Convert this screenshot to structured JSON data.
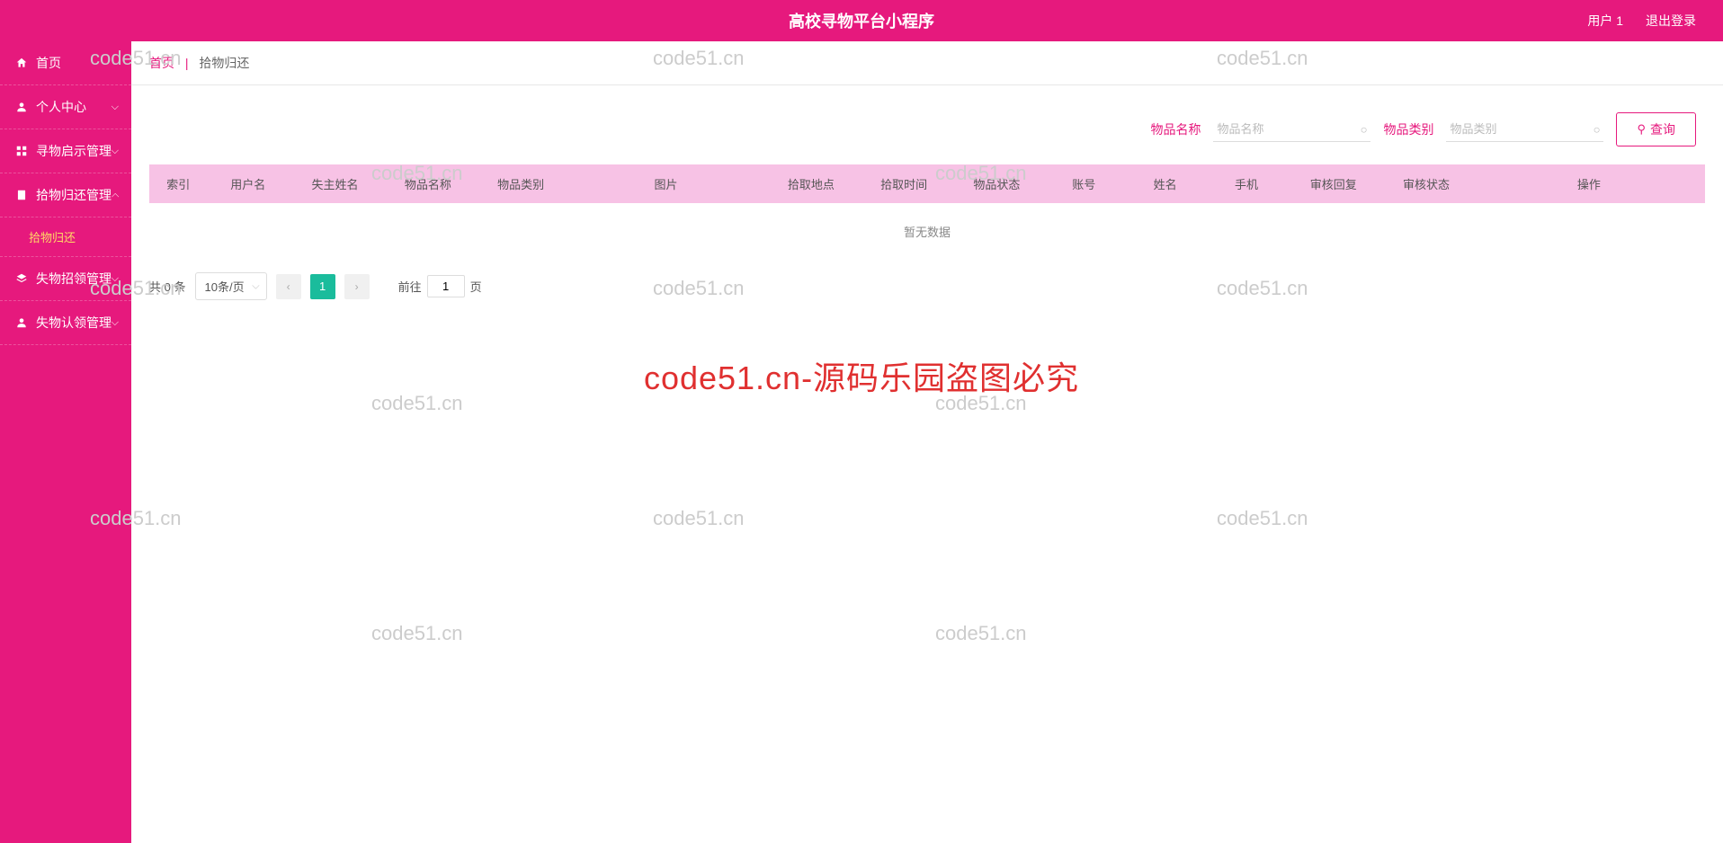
{
  "header": {
    "title": "高校寻物平台小程序",
    "user": "用户 1",
    "logout": "退出登录"
  },
  "sidebar": {
    "items": [
      {
        "label": "首页",
        "icon": "home",
        "expandable": false
      },
      {
        "label": "个人中心",
        "icon": "user",
        "expandable": true
      },
      {
        "label": "寻物启示管理",
        "icon": "grid",
        "expandable": true
      },
      {
        "label": "拾物归还管理",
        "icon": "doc",
        "expandable": true,
        "expanded": true,
        "children": [
          {
            "label": "拾物归还"
          }
        ]
      },
      {
        "label": "失物招领管理",
        "icon": "layers",
        "expandable": true
      },
      {
        "label": "失物认领管理",
        "icon": "user",
        "expandable": true
      }
    ]
  },
  "breadcrumb": {
    "home": "首页",
    "current": "拾物归还"
  },
  "search": {
    "label1": "物品名称",
    "placeholder1": "物品名称",
    "label2": "物品类别",
    "placeholder2": "物品类别",
    "button": "查询"
  },
  "table": {
    "columns": [
      "索引",
      "用户名",
      "失主姓名",
      "物品名称",
      "物品类别",
      "图片",
      "拾取地点",
      "拾取时间",
      "物品状态",
      "账号",
      "姓名",
      "手机",
      "审核回复",
      "审核状态",
      "操作"
    ],
    "empty": "暂无数据"
  },
  "pagination": {
    "total_prefix": "共",
    "total_count": "0",
    "total_suffix": "条",
    "per_page": "10条/页",
    "current": "1",
    "goto_prefix": "前往",
    "goto_value": "1",
    "goto_suffix": "页"
  },
  "watermarks": {
    "text": "code51.cn",
    "center": "code51.cn-源码乐园盗图必究"
  }
}
